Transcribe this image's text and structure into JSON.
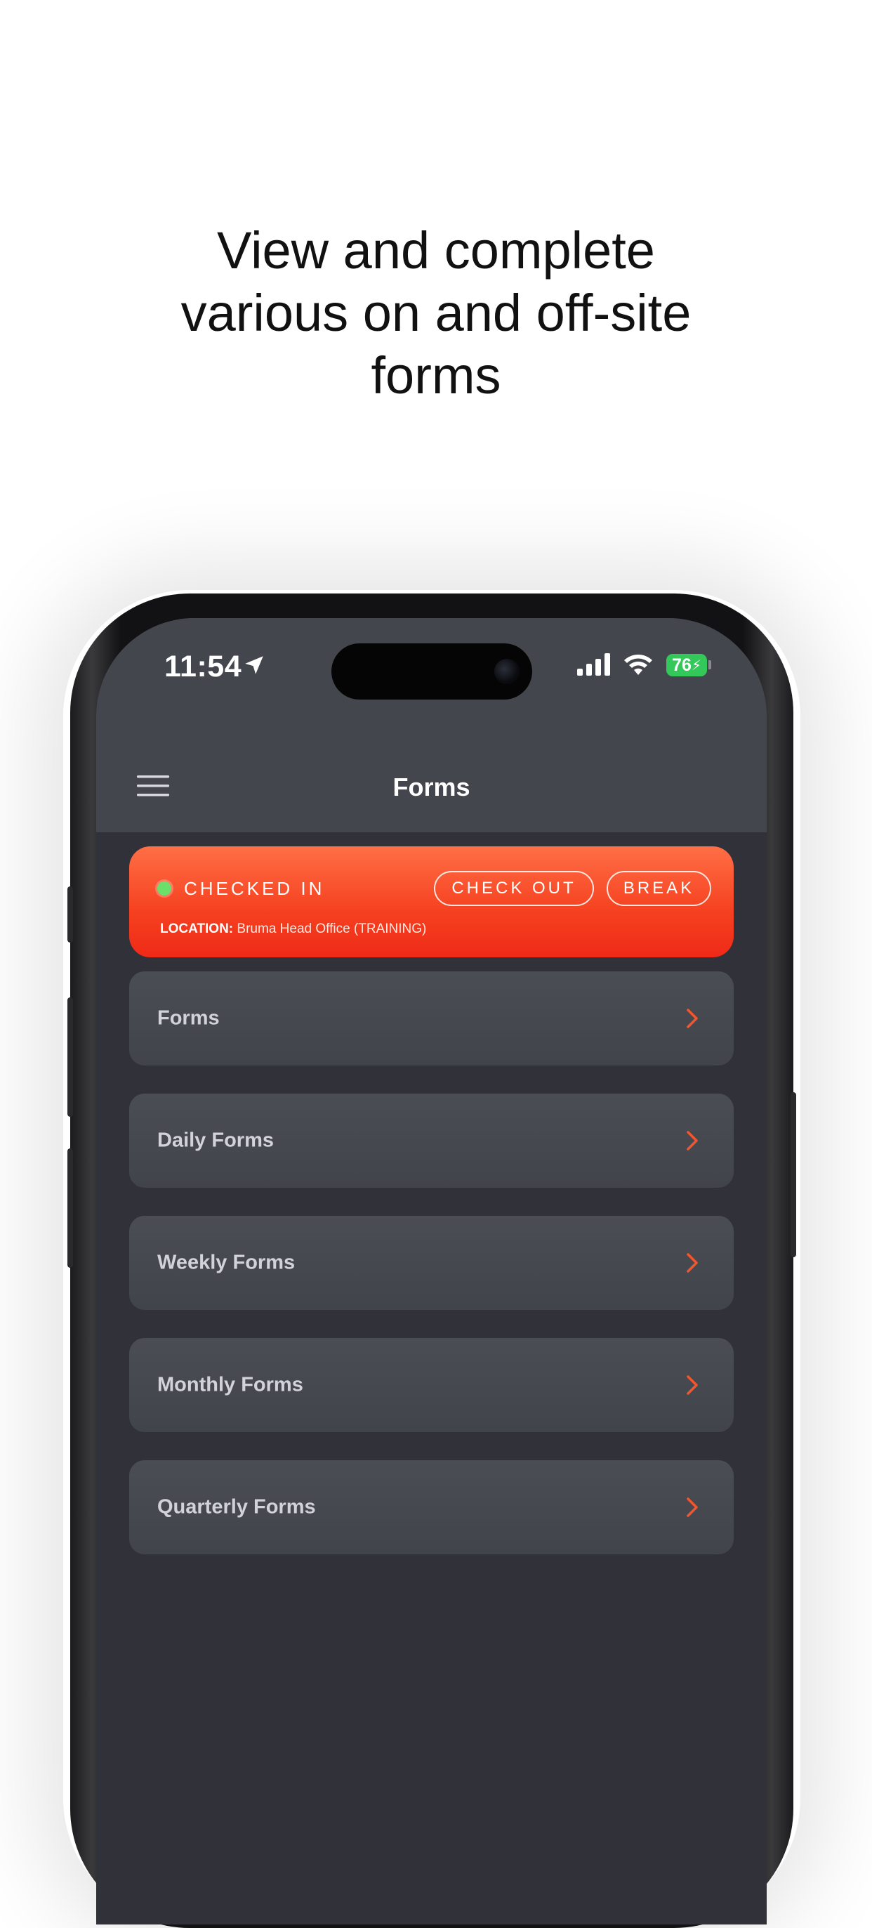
{
  "headline": {
    "line1": "View and complete",
    "line2": "various on and off-site",
    "line3": "forms"
  },
  "status_bar": {
    "time": "11:54",
    "battery": "76",
    "battery_color": "#34c759",
    "icons": [
      "location-arrow-icon",
      "signal-icon",
      "wifi-icon",
      "battery-icon"
    ]
  },
  "header": {
    "title": "Forms",
    "menu_icon": "hamburger-menu-icon"
  },
  "checkin": {
    "status": "CHECKED IN",
    "status_color": "#6ae06a",
    "checkout_label": "CHECK OUT",
    "break_label": "BREAK",
    "location_label": "LOCATION:",
    "location_value": " Bruma Head Office (TRAINING)",
    "gradient_top": "#ff6f46",
    "gradient_bottom": "#ef2a18"
  },
  "menu": {
    "items": [
      {
        "label": "Forms"
      },
      {
        "label": "Daily Forms"
      },
      {
        "label": "Weekly Forms"
      },
      {
        "label": "Monthly Forms"
      },
      {
        "label": "Quarterly Forms"
      }
    ],
    "chevron_color": "#f0572e",
    "chevron_icon": "chevron-right-icon"
  },
  "colors": {
    "screen_bg": "#303139",
    "header_bg": "#44464e",
    "row_bg": "#4b4d55"
  }
}
